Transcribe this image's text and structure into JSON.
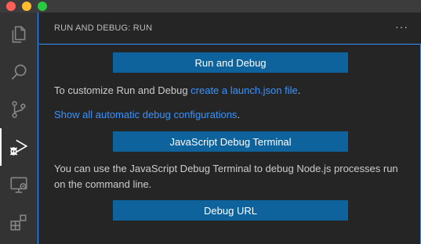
{
  "window": {
    "traffic_lights": [
      "close",
      "minimize",
      "maximize"
    ]
  },
  "activity_bar": {
    "items": [
      {
        "icon": "files-icon"
      },
      {
        "icon": "search-icon"
      },
      {
        "icon": "source-control-icon"
      },
      {
        "icon": "run-debug-icon",
        "active": true
      },
      {
        "icon": "remote-explorer-icon"
      },
      {
        "icon": "extensions-icon"
      }
    ]
  },
  "sidebar": {
    "title": "RUN AND DEBUG: RUN",
    "more_label": "···",
    "run_and_debug_button": "Run and Debug",
    "customize_text": "To customize Run and Debug ",
    "customize_link": "create a launch.json file",
    "customize_suffix": ".",
    "show_all_link": "Show all automatic debug configurations",
    "show_all_suffix": ".",
    "js_terminal_button": "JavaScript Debug Terminal",
    "js_terminal_desc": "You can use the JavaScript Debug Terminal to debug Node.js processes run on the command line.",
    "debug_url_button": "Debug URL"
  },
  "colors": {
    "accent": "#3794ff",
    "button": "#0e639c",
    "activity_bar": "#333333",
    "sidebar": "#252526"
  }
}
